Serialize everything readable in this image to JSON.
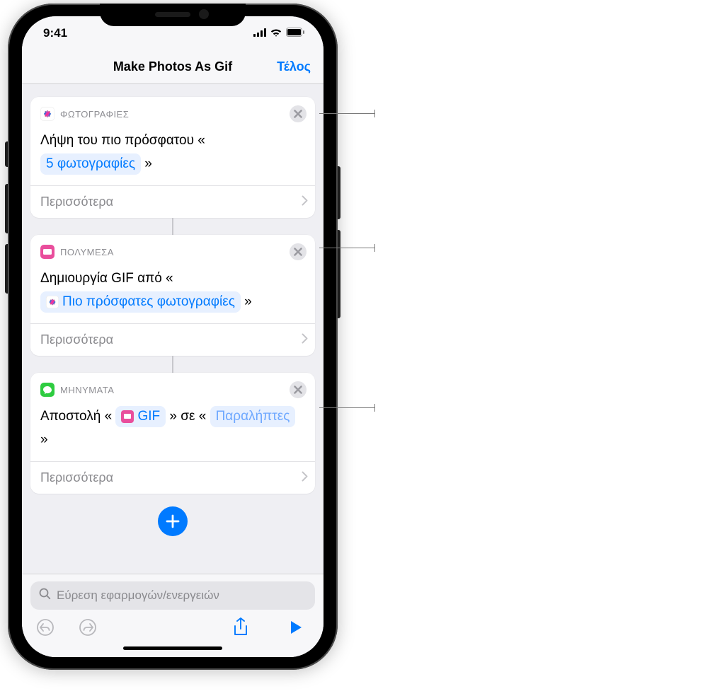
{
  "status": {
    "time": "9:41"
  },
  "nav": {
    "title": "Make Photos As Gif",
    "done": "Τέλος"
  },
  "card1": {
    "app": "ΦΩΤΟΓΡΑΦΙΕΣ",
    "body_prefix": "Λήψη του πιο πρόσφατου «",
    "token_count": "5 φωτογραφίες",
    "body_suffix": "»",
    "more": "Περισσότερα"
  },
  "card2": {
    "app": "ΠΟΛΥΜΕΣΑ",
    "body_prefix": "Δημιουργία GIF από «",
    "token": "Πιο πρόσφατες φωτογραφίες",
    "body_suffix": "»",
    "more": "Περισσότερα"
  },
  "card3": {
    "app": "ΜΗΝΥΜΑΤΑ",
    "line1_prefix": "Αποστολή «",
    "token_gif": "GIF",
    "line1_mid": "» σε «",
    "token_recipients": "Παραλήπτες",
    "line1_suffix": "»",
    "more": "Περισσότερα"
  },
  "search": {
    "placeholder": "Εύρεση εφαρμογών/ενεργειών"
  }
}
